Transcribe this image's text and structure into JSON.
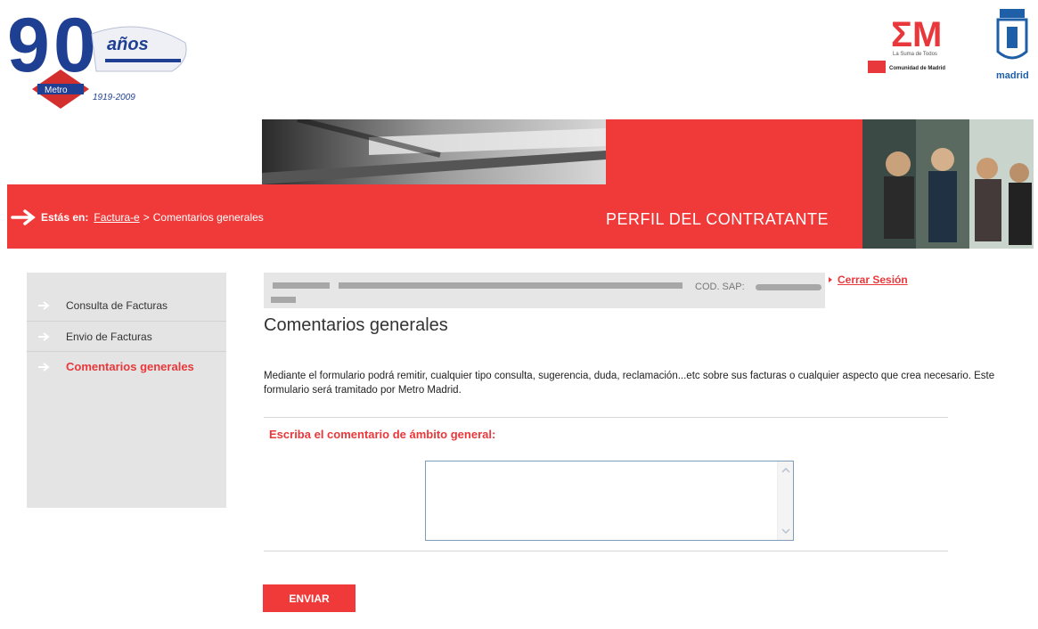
{
  "header": {
    "logo90_years": "1919-2009",
    "logo90_text": "Metro",
    "logo90_anos": "años",
    "em_subtitle": "La Suma de Todos",
    "em_org": "Comunidad de Madrid",
    "madrid_label": "madrid"
  },
  "banner": {
    "estas_en": "Estás en:",
    "crumb_link": "Factura-e",
    "crumb_sep": ">",
    "crumb_current": "Comentarios generales",
    "section_title": "PERFIL DEL CONTRATANTE"
  },
  "sidebar": {
    "items": [
      {
        "label": "Consulta de Facturas",
        "active": false
      },
      {
        "label": "Envio de Facturas",
        "active": false
      },
      {
        "label": "Comentarios generales",
        "active": true
      }
    ]
  },
  "userbar": {
    "cod_label": "COD. SAP:",
    "logout": "Cerrar Sesión"
  },
  "main": {
    "title": "Comentarios generales",
    "description": "Mediante el formulario podrá remitir, cualquier tipo consulta, sugerencia, duda, reclamación...etc sobre sus facturas o cualquier aspecto que crea necesario. Este formulario será tramitado por Metro Madrid.",
    "form_label": "Escriba el comentario de ámbito general:",
    "comment_value": "",
    "submit": "ENVIAR"
  },
  "colors": {
    "brand_red": "#f03a3a",
    "accent_red": "#e8383b"
  }
}
